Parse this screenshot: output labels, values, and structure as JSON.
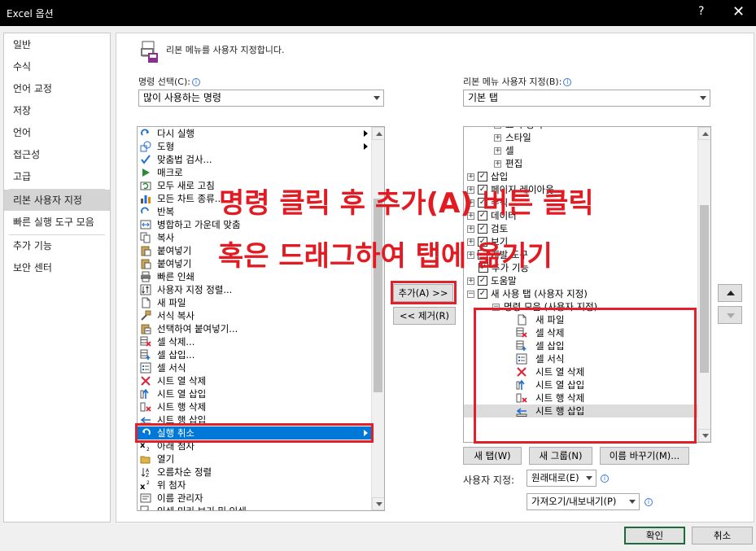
{
  "window": {
    "title": "Excel 옵션",
    "help": "?",
    "close": "✕"
  },
  "nav": {
    "items": [
      "일반",
      "수식",
      "언어 교정",
      "저장",
      "언어",
      "접근성",
      "고급",
      "리본 사용자 지정",
      "빠른 실행 도구 모음",
      "추가 기능",
      "보안 센터"
    ],
    "selected": "리본 사용자 지정"
  },
  "main": {
    "heading": "리본 메뉴를 사용자 지정합니다.",
    "left_label": "명령 선택(C):",
    "left_combo": "많이 사용하는 명령",
    "right_label": "리본 메뉴 사용자 지정(B):",
    "right_combo": "기본 탭"
  },
  "commands": [
    {
      "label": "다시 실행",
      "icon": "redo-icon",
      "submenu": true
    },
    {
      "label": "도형",
      "icon": "shapes-icon",
      "submenu": true
    },
    {
      "label": "맞춤법 검사...",
      "icon": "spelling-icon",
      "submenu": false
    },
    {
      "label": "매크로",
      "icon": "macro-icon",
      "submenu": false
    },
    {
      "label": "모두 새로 고침",
      "icon": "refresh-all-icon",
      "submenu": false
    },
    {
      "label": "모든 차트 종류...",
      "icon": "chart-types-icon",
      "submenu": false
    },
    {
      "label": "반복",
      "icon": "repeat-icon",
      "submenu": false
    },
    {
      "label": "병합하고 가운데 맞춤",
      "icon": "merge-center-icon",
      "submenu": false
    },
    {
      "label": "복사",
      "icon": "copy-icon",
      "submenu": false
    },
    {
      "label": "붙여넣기",
      "icon": "paste-icon",
      "submenu": false
    },
    {
      "label": "붙여넣기",
      "icon": "paste-icon",
      "submenu": false
    },
    {
      "label": "빠른 인쇄",
      "icon": "quick-print-icon",
      "submenu": false
    },
    {
      "label": "사용자 지정 정렬...",
      "icon": "custom-sort-icon",
      "submenu": false
    },
    {
      "label": "새 파일",
      "icon": "new-file-icon",
      "submenu": false
    },
    {
      "label": "서식 복사",
      "icon": "format-painter-icon",
      "submenu": false
    },
    {
      "label": "선택하여 붙여넣기...",
      "icon": "paste-special-icon",
      "submenu": false
    },
    {
      "label": "셀 삭제...",
      "icon": "delete-cells-icon",
      "submenu": false
    },
    {
      "label": "셀 삽입...",
      "icon": "insert-cells-icon",
      "submenu": false
    },
    {
      "label": "셀 서식",
      "icon": "format-cells-icon",
      "submenu": false
    },
    {
      "label": "시트 열 삭제",
      "icon": "delete-column-icon",
      "submenu": false
    },
    {
      "label": "시트 열 삽입",
      "icon": "insert-column-icon",
      "submenu": false
    },
    {
      "label": "시트 행 삭제",
      "icon": "delete-row-icon",
      "submenu": false
    },
    {
      "label": "시트 행 삽입",
      "icon": "insert-row-icon",
      "submenu": false
    },
    {
      "label": "실행 취소",
      "icon": "undo-icon",
      "submenu": true
    },
    {
      "label": "아래 첨자",
      "icon": "subscript-icon",
      "submenu": false
    },
    {
      "label": "열기",
      "icon": "open-icon",
      "submenu": false
    },
    {
      "label": "오름차순 정렬",
      "icon": "sort-ascending-icon",
      "submenu": false
    },
    {
      "label": "위 첨자",
      "icon": "superscript-icon",
      "submenu": false
    },
    {
      "label": "이름 관리자",
      "icon": "name-manager-icon",
      "submenu": false
    },
    {
      "label": "인쇄 미리 보기 및 인쇄",
      "icon": "print-preview-icon",
      "submenu": false
    }
  ],
  "selected_command": "실행 취소",
  "buttons": {
    "add": "추가(A) >>",
    "remove": "<< 제거(R)",
    "new_tab": "새 탭(W)",
    "new_group": "새 그룹(N)",
    "rename": "이름 바꾸기(M)...",
    "ok": "확인",
    "cancel": "취소"
  },
  "tree": [
    {
      "label": "표시 형식",
      "level": 2,
      "expander": "+",
      "checkbox": null
    },
    {
      "label": "스타일",
      "level": 2,
      "expander": "+",
      "checkbox": null
    },
    {
      "label": "셀",
      "level": 2,
      "expander": "+",
      "checkbox": null
    },
    {
      "label": "편집",
      "level": 2,
      "expander": "+",
      "checkbox": null
    },
    {
      "label": "삽입",
      "level": 0,
      "expander": "+",
      "checkbox": true
    },
    {
      "label": "페이지 레이아웃",
      "level": 0,
      "expander": "+",
      "checkbox": true
    },
    {
      "label": "수식",
      "level": 0,
      "expander": "+",
      "checkbox": true
    },
    {
      "label": "데이터",
      "level": 0,
      "expander": "+",
      "checkbox": true
    },
    {
      "label": "검토",
      "level": 0,
      "expander": "+",
      "checkbox": true
    },
    {
      "label": "보기",
      "level": 0,
      "expander": "+",
      "checkbox": true
    },
    {
      "label": "개발 도구",
      "level": 0,
      "expander": "+",
      "checkbox": false
    },
    {
      "label": "추가 기능",
      "level": 0,
      "expander": null,
      "checkbox": true
    },
    {
      "label": "도움말",
      "level": 0,
      "expander": "+",
      "checkbox": true
    },
    {
      "label": "새 사용 탭 (사용자 지정)",
      "level": 0,
      "expander": "−",
      "checkbox": true
    },
    {
      "label": "명령 모음 (사용자 지정)",
      "level": 1,
      "expander": "−",
      "checkbox": null
    },
    {
      "label": "새 파일",
      "level": 3,
      "icon": "new-file-icon"
    },
    {
      "label": "셀 삭제",
      "level": 3,
      "icon": "delete-cells-icon"
    },
    {
      "label": "셀 삽입",
      "level": 3,
      "icon": "insert-cells-icon"
    },
    {
      "label": "셀 서식",
      "level": 3,
      "icon": "format-cells-icon"
    },
    {
      "label": "시트 열 삭제",
      "level": 3,
      "icon": "delete-column-icon"
    },
    {
      "label": "시트 열 삽입",
      "level": 3,
      "icon": "insert-column-icon"
    },
    {
      "label": "시트 행 삭제",
      "level": 3,
      "icon": "delete-row-icon"
    },
    {
      "label": "시트 행 삽입",
      "level": 3,
      "icon": "insert-row-icon"
    }
  ],
  "customizations": {
    "label": "사용자 지정:",
    "reset": "원래대로(E)",
    "import_export": "가져오기/내보내기(P)"
  },
  "overlay": {
    "line1": "명령 클릭 후 추가(A) 버튼 클릭",
    "line2": "혹은 드래그하여 탭에 옮기기"
  },
  "colors": {
    "highlight": "#0078d7",
    "annotation": "#e21b23",
    "ok_border": "#1d6b3a"
  }
}
